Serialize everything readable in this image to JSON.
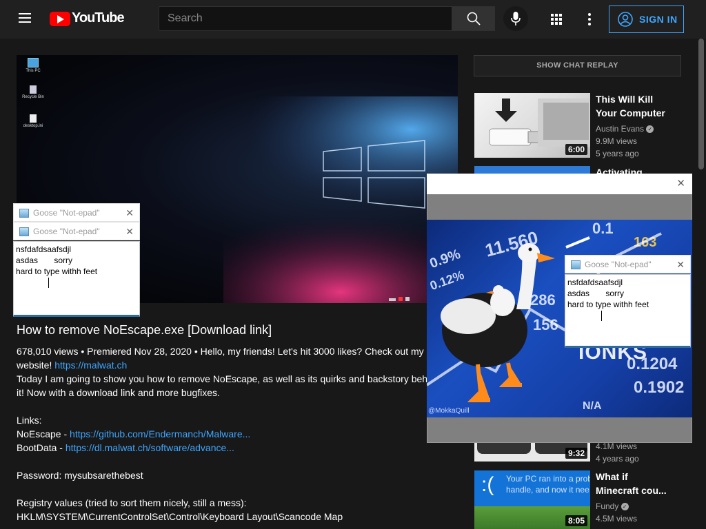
{
  "header": {
    "logo_text": "YouTube",
    "search_placeholder": "Search",
    "signin_label": "SIGN IN"
  },
  "video": {
    "desktop_icons": [
      "This PC",
      "Recycle Bin",
      "desktop.ini"
    ],
    "title": "How to remove NoEscape.exe [Download link]",
    "description_lines": [
      {
        "text": "678,010 views • Premiered Nov 28, 2020 • Hello, my friends! Let's hit 3000 likes? Check out my",
        "link": ""
      },
      {
        "text": "website! ",
        "link": "https://malwat.ch"
      },
      {
        "text": "Today I am going to show you how to remove NoEscape, as well as its quirks and backstory behind",
        "link": ""
      },
      {
        "text": "it! Now with a download link and more bugfixes.",
        "link": ""
      },
      {
        "text": "",
        "link": ""
      },
      {
        "text": "Links:",
        "link": ""
      },
      {
        "text": "NoEscape - ",
        "link": "https://github.com/Endermanch/Malware..."
      },
      {
        "text": "BootData - ",
        "link": "https://dl.malwat.ch/software/advance..."
      },
      {
        "text": "",
        "link": ""
      },
      {
        "text": "Password: mysubsarethebest",
        "link": ""
      },
      {
        "text": "",
        "link": ""
      },
      {
        "text": "Registry values (tried to sort them nicely, still a mess):",
        "link": ""
      },
      {
        "text": "HKLM\\SYSTEM\\CurrentControlSet\\Control\\Keyboard Layout\\Scancode Map",
        "link": ""
      }
    ]
  },
  "sidebar": {
    "chat_replay_label": "SHOW CHAT REPLAY",
    "recommendations": [
      {
        "title_lines": [
          "This Will Kill",
          "Your Computer"
        ],
        "channel": "Austin Evans",
        "verified": true,
        "views": "9.9M views",
        "age": "5 years ago",
        "duration": "6:00"
      },
      {
        "title_lines": [
          "Activating"
        ],
        "channel": "",
        "verified": false,
        "views": "",
        "age": "",
        "duration": ""
      },
      {
        "title_lines": [],
        "channel": "",
        "verified": false,
        "views": "4.1M views",
        "age": "4 years ago",
        "duration": "9:32"
      },
      {
        "title_lines": [
          "What if",
          "Minecraft cou..."
        ],
        "channel": "Fundy",
        "verified": true,
        "views": "4.5M views",
        "age": "",
        "duration": "8:05"
      }
    ],
    "thumb4_text": [
      "Your PC ran into a prob",
      "handle, and now it nee"
    ]
  },
  "notepads": {
    "title": "Goose \"Not-epad\"",
    "lines": [
      "nsfdafdsaafsdjl",
      "asdas       sorry",
      "hard to type withh feet"
    ]
  },
  "meme": {
    "tickers": [
      "11.560",
      "0.9%",
      "0.12%",
      "286",
      "156",
      "0.1204",
      "0.1902",
      "N/A",
      "0.1",
      "163",
      "IONKS"
    ],
    "credit": "@MokkaQuill"
  },
  "colors": {
    "background": "#181818",
    "header": "#202020",
    "link": "#3ea6ff",
    "brand_red": "#ff0000"
  }
}
